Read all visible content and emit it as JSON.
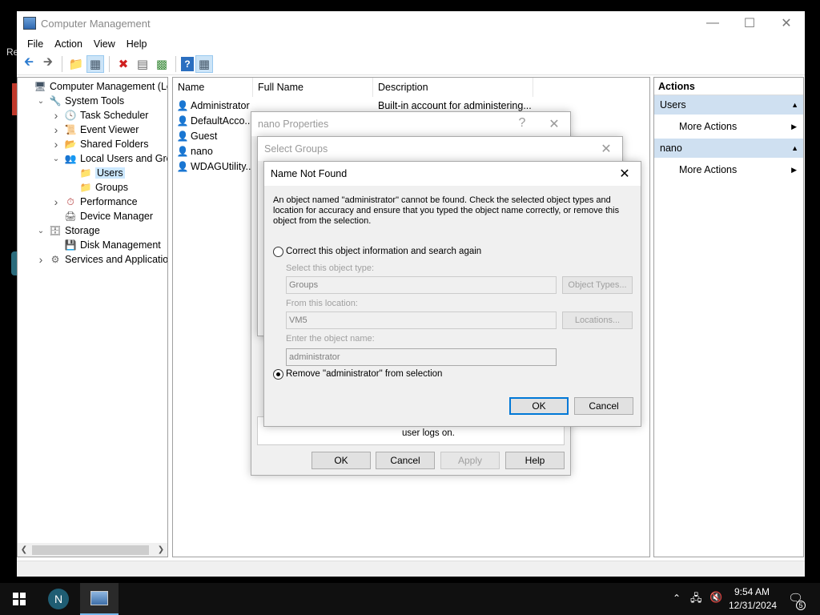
{
  "window": {
    "title": "Computer Management",
    "menu": [
      "File",
      "Action",
      "View",
      "Help"
    ]
  },
  "tree": [
    {
      "label": "Computer Management (Local",
      "indent": 0,
      "expander": "",
      "icon": "computer-management-icon"
    },
    {
      "label": "System Tools",
      "indent": 1,
      "expander": "open",
      "icon": "tools-icon"
    },
    {
      "label": "Task Scheduler",
      "indent": 2,
      "expander": "closed",
      "icon": "clock-icon"
    },
    {
      "label": "Event Viewer",
      "indent": 2,
      "expander": "closed",
      "icon": "event-viewer-icon"
    },
    {
      "label": "Shared Folders",
      "indent": 2,
      "expander": "closed",
      "icon": "shared-folder-icon"
    },
    {
      "label": "Local Users and Groups",
      "indent": 2,
      "expander": "open",
      "icon": "users-icon"
    },
    {
      "label": "Users",
      "indent": 3,
      "expander": "",
      "icon": "folder-icon",
      "selected": true
    },
    {
      "label": "Groups",
      "indent": 3,
      "expander": "",
      "icon": "folder-icon"
    },
    {
      "label": "Performance",
      "indent": 2,
      "expander": "closed",
      "icon": "performance-icon"
    },
    {
      "label": "Device Manager",
      "indent": 2,
      "expander": "",
      "icon": "device-manager-icon"
    },
    {
      "label": "Storage",
      "indent": 1,
      "expander": "open",
      "icon": "storage-icon"
    },
    {
      "label": "Disk Management",
      "indent": 2,
      "expander": "",
      "icon": "disk-icon"
    },
    {
      "label": "Services and Applications",
      "indent": 1,
      "expander": "closed",
      "icon": "services-icon"
    }
  ],
  "list": {
    "columns": [
      "Name",
      "Full Name",
      "Description"
    ],
    "rows": [
      {
        "name": "Administrator",
        "full_name": "",
        "description": "Built-in account for administering..."
      },
      {
        "name": "DefaultAcco...",
        "full_name": "",
        "description": ""
      },
      {
        "name": "Guest",
        "full_name": "",
        "description": ""
      },
      {
        "name": "nano",
        "full_name": "",
        "description": ""
      },
      {
        "name": "WDAGUtility...",
        "full_name": "",
        "description": ""
      }
    ]
  },
  "actions": {
    "header": "Actions",
    "sections": [
      {
        "title": "Users",
        "item": "More Actions"
      },
      {
        "title": "nano",
        "item": "More Actions"
      }
    ]
  },
  "nano_properties": {
    "title": "nano Properties",
    "help_glyph": "?",
    "partial_text": "user logs on.",
    "buttons": {
      "ok": "OK",
      "cancel": "Cancel",
      "apply": "Apply",
      "help": "Help"
    }
  },
  "select_groups": {
    "title": "Select Groups"
  },
  "name_not_found": {
    "title": "Name Not Found",
    "message": "An object named \"administrator\" cannot be found. Check the selected object types and location for accuracy and ensure that you typed the object name correctly, or remove this object from the selection.",
    "option_correct": "Correct this object information and search again",
    "label_type": "Select this object type:",
    "value_type": "Groups",
    "btn_object_types": "Object Types...",
    "label_location": "From this location:",
    "value_location": "VM5",
    "btn_locations": "Locations...",
    "label_name": "Enter the object name:",
    "value_name": "administrator",
    "option_remove": "Remove \"administrator\" from selection",
    "selected_option": "remove",
    "ok": "OK",
    "cancel": "Cancel"
  },
  "taskbar": {
    "time": "9:54 AM",
    "date": "12/31/2024",
    "notification_count": "5"
  }
}
